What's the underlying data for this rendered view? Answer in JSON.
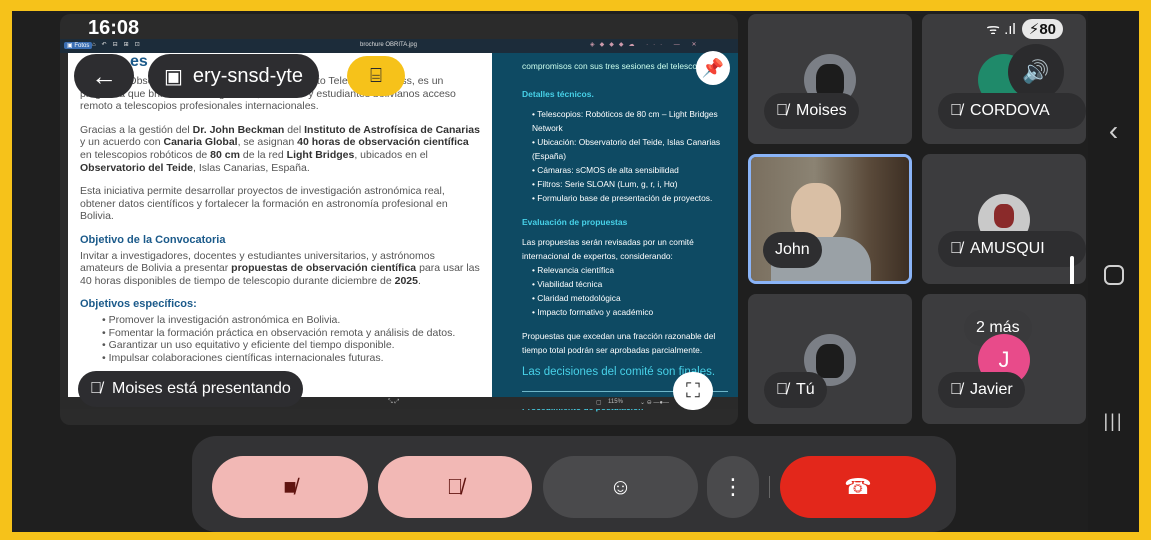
{
  "status": {
    "time": "16:08",
    "signal": "ᯤ .ıl",
    "battery": "80"
  },
  "presentation": {
    "viewer_title": "brochure OBRITA.jpg",
    "zoom": "115%",
    "left_page": {
      "heading_partial": "es",
      "intro": "O.R.I.T.A. Observatory for Remote Bol. Integration to Telescope Access, es un programa que brinda a investigadores, docentes y estudiantes bolivianos acceso remoto a telescopios profesionales internacionales.",
      "para2_a": "Gracias a la gestión del ",
      "para2_b": "Dr. John Beckman",
      "para2_c": " del ",
      "para2_d": "Instituto de Astrofísica de Canarias",
      "para2_e": " y un acuerdo con ",
      "para2_f": "Canaria Global",
      "para2_g": ", se asignan ",
      "para2_h": "40 horas de observación científica",
      "para2_i": " en telescopios robóticos de ",
      "para2_j": "80 cm",
      "para2_k": " de la red ",
      "para2_l": "Light Bridges",
      "para2_m": ", ubicados en el ",
      "para2_n": "Observatorio del Teide",
      "para2_o": ", Islas Canarias, España.",
      "para3": "Esta iniciativa permite desarrollar proyectos de investigación astronómica real, obtener datos científicos y fortalecer la formación en astronomía profesional en Bolivia.",
      "h_objetivo": "Objetivo de la Convocatoria",
      "objetivo_a": "Invitar a investigadores, docentes y estudiantes universitarios, y astrónomos amateurs de Bolivia a presentar ",
      "objetivo_b": "propuestas de observación científica",
      "objetivo_c": " para usar las 40 horas disponibles de tiempo de telescopio durante diciembre de ",
      "objetivo_d": "2025",
      "objetivo_e": ".",
      "h_especificos": "Objetivos específicos:",
      "especificos": [
        "Promover la investigación astronómica en Bolivia.",
        "Fomentar la formación práctica en observación remota y análisis de datos.",
        "Garantizar un uso equitativo y eficiente del tiempo disponible.",
        "Impulsar colaboraciones científicas internacionales futuras."
      ]
    },
    "right_page": {
      "top_partial": "compromisos con sus tres sesiones del telescopio.",
      "h_detalles": "Detalles técnicos.",
      "detalles": [
        "Telescopios: Robóticos de 80 cm – Light Bridges Network",
        "Ubicación: Observatorio del Teide, Islas Canarias (España)",
        "Cámaras: sCMOS de alta sensibilidad",
        "Filtros: Serie SLOAN (Lum, g, r, i, Hα)",
        "Formulario base de presentación de proyectos."
      ],
      "h_evaluacion": "Evaluación de propuestas",
      "eval_intro": "Las propuestas serán revisadas por un comité internacional de expertos, considerando:",
      "criterios": [
        "Relevancia científica",
        "Viabilidad técnica",
        "Claridad metodológica",
        "Impacto formativo y académico"
      ],
      "fraccion": "Propuestas que excedan una fracción razonable del tiempo total podrán ser aprobadas parcialmente.",
      "finales": "Las decisiones del comité son finales.",
      "h_procedimiento": "Procedimiento de postulación"
    },
    "meeting_code": "ery-snsd-yte",
    "presenting_label": "Moises está presentando"
  },
  "participants": [
    {
      "name": "Moises",
      "muted": true
    },
    {
      "name": "CORDOVA",
      "muted": true
    },
    {
      "name": "John",
      "muted": false
    },
    {
      "name": "AMUSQUI",
      "muted": true
    },
    {
      "name": "Tú",
      "muted": true
    },
    {
      "name": "Javier",
      "muted": true,
      "more": "2 más",
      "initial": "J"
    }
  ],
  "colors": {
    "frame": "#f6c21a",
    "exit": "#f6c21a",
    "off_button": "#f2b8b5",
    "end_call": "#e3271b",
    "speaking_border": "#8ab4f8"
  }
}
